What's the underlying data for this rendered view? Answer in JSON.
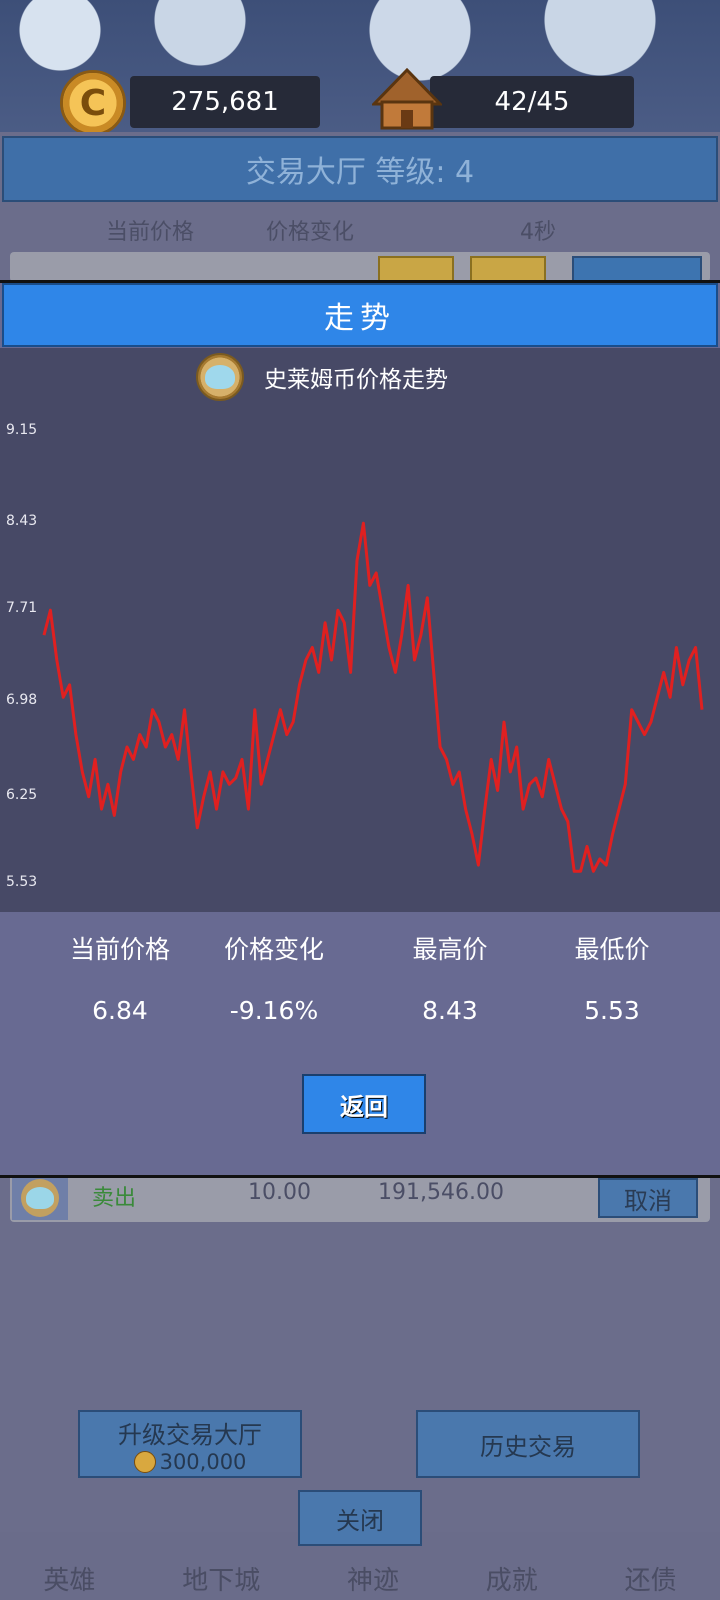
{
  "hud": {
    "gold": "275,681",
    "housing": "42/45",
    "coin_symbol": "C",
    "icons": [
      "gold-coin-icon",
      "house-icon"
    ]
  },
  "hall": {
    "title": "交易大厅 等级: 4",
    "col_current_price": "当前价格",
    "col_price_change": "价格变化",
    "timer": "4秒"
  },
  "order": {
    "side": "卖出",
    "amount": "10.00",
    "total": "191,546.00",
    "cancel": "取消"
  },
  "actions": {
    "upgrade": "升级交易大厅",
    "upgrade_cost": "300,000",
    "history": "历史交易",
    "close": "关闭"
  },
  "tabs": [
    "英雄",
    "地下城",
    "神迹",
    "成就",
    "还债"
  ],
  "modal": {
    "header": "走势",
    "chart_title": "史莱姆币价格走势",
    "stats": {
      "current_label": "当前价格",
      "change_label": "价格变化",
      "high_label": "最高价",
      "low_label": "最低价",
      "current": "6.84",
      "change": "-9.16%",
      "high": "8.43",
      "low": "5.53"
    },
    "back": "返回"
  },
  "chart_data": {
    "type": "line",
    "title": "史莱姆币价格走势",
    "y_ticks": [
      "9.15",
      "8.43",
      "7.71",
      "6.98",
      "6.25",
      "5.53"
    ],
    "ylim": [
      5.53,
      9.15
    ],
    "grid": false,
    "color": "#e02020",
    "series": [
      {
        "values": [
          7.5,
          7.7,
          7.3,
          7.0,
          7.1,
          6.7,
          6.4,
          6.2,
          6.5,
          6.1,
          6.3,
          6.05,
          6.4,
          6.6,
          6.5,
          6.7,
          6.6,
          6.9,
          6.8,
          6.6,
          6.7,
          6.5,
          6.9,
          6.4,
          5.95,
          6.2,
          6.4,
          6.1,
          6.4,
          6.3,
          6.35,
          6.5,
          6.1,
          6.9,
          6.3,
          6.5,
          6.7,
          6.9,
          6.7,
          6.8,
          7.1,
          7.3,
          7.4,
          7.2,
          7.6,
          7.3,
          7.7,
          7.6,
          7.2,
          8.1,
          8.4,
          7.9,
          8.0,
          7.7,
          7.4,
          7.2,
          7.5,
          7.9,
          7.3,
          7.5,
          7.8,
          7.2,
          6.6,
          6.5,
          6.3,
          6.4,
          6.1,
          5.9,
          5.65,
          6.1,
          6.5,
          6.25,
          6.8,
          6.4,
          6.6,
          6.1,
          6.3,
          6.35,
          6.2,
          6.5,
          6.3,
          6.1,
          6.0,
          5.6,
          5.6,
          5.8,
          5.6,
          5.7,
          5.65,
          5.9,
          6.1,
          6.3,
          6.9,
          6.8,
          6.7,
          6.8,
          7.0,
          7.2,
          7.0,
          7.4,
          7.1,
          7.3,
          7.4,
          6.9
        ]
      }
    ]
  }
}
